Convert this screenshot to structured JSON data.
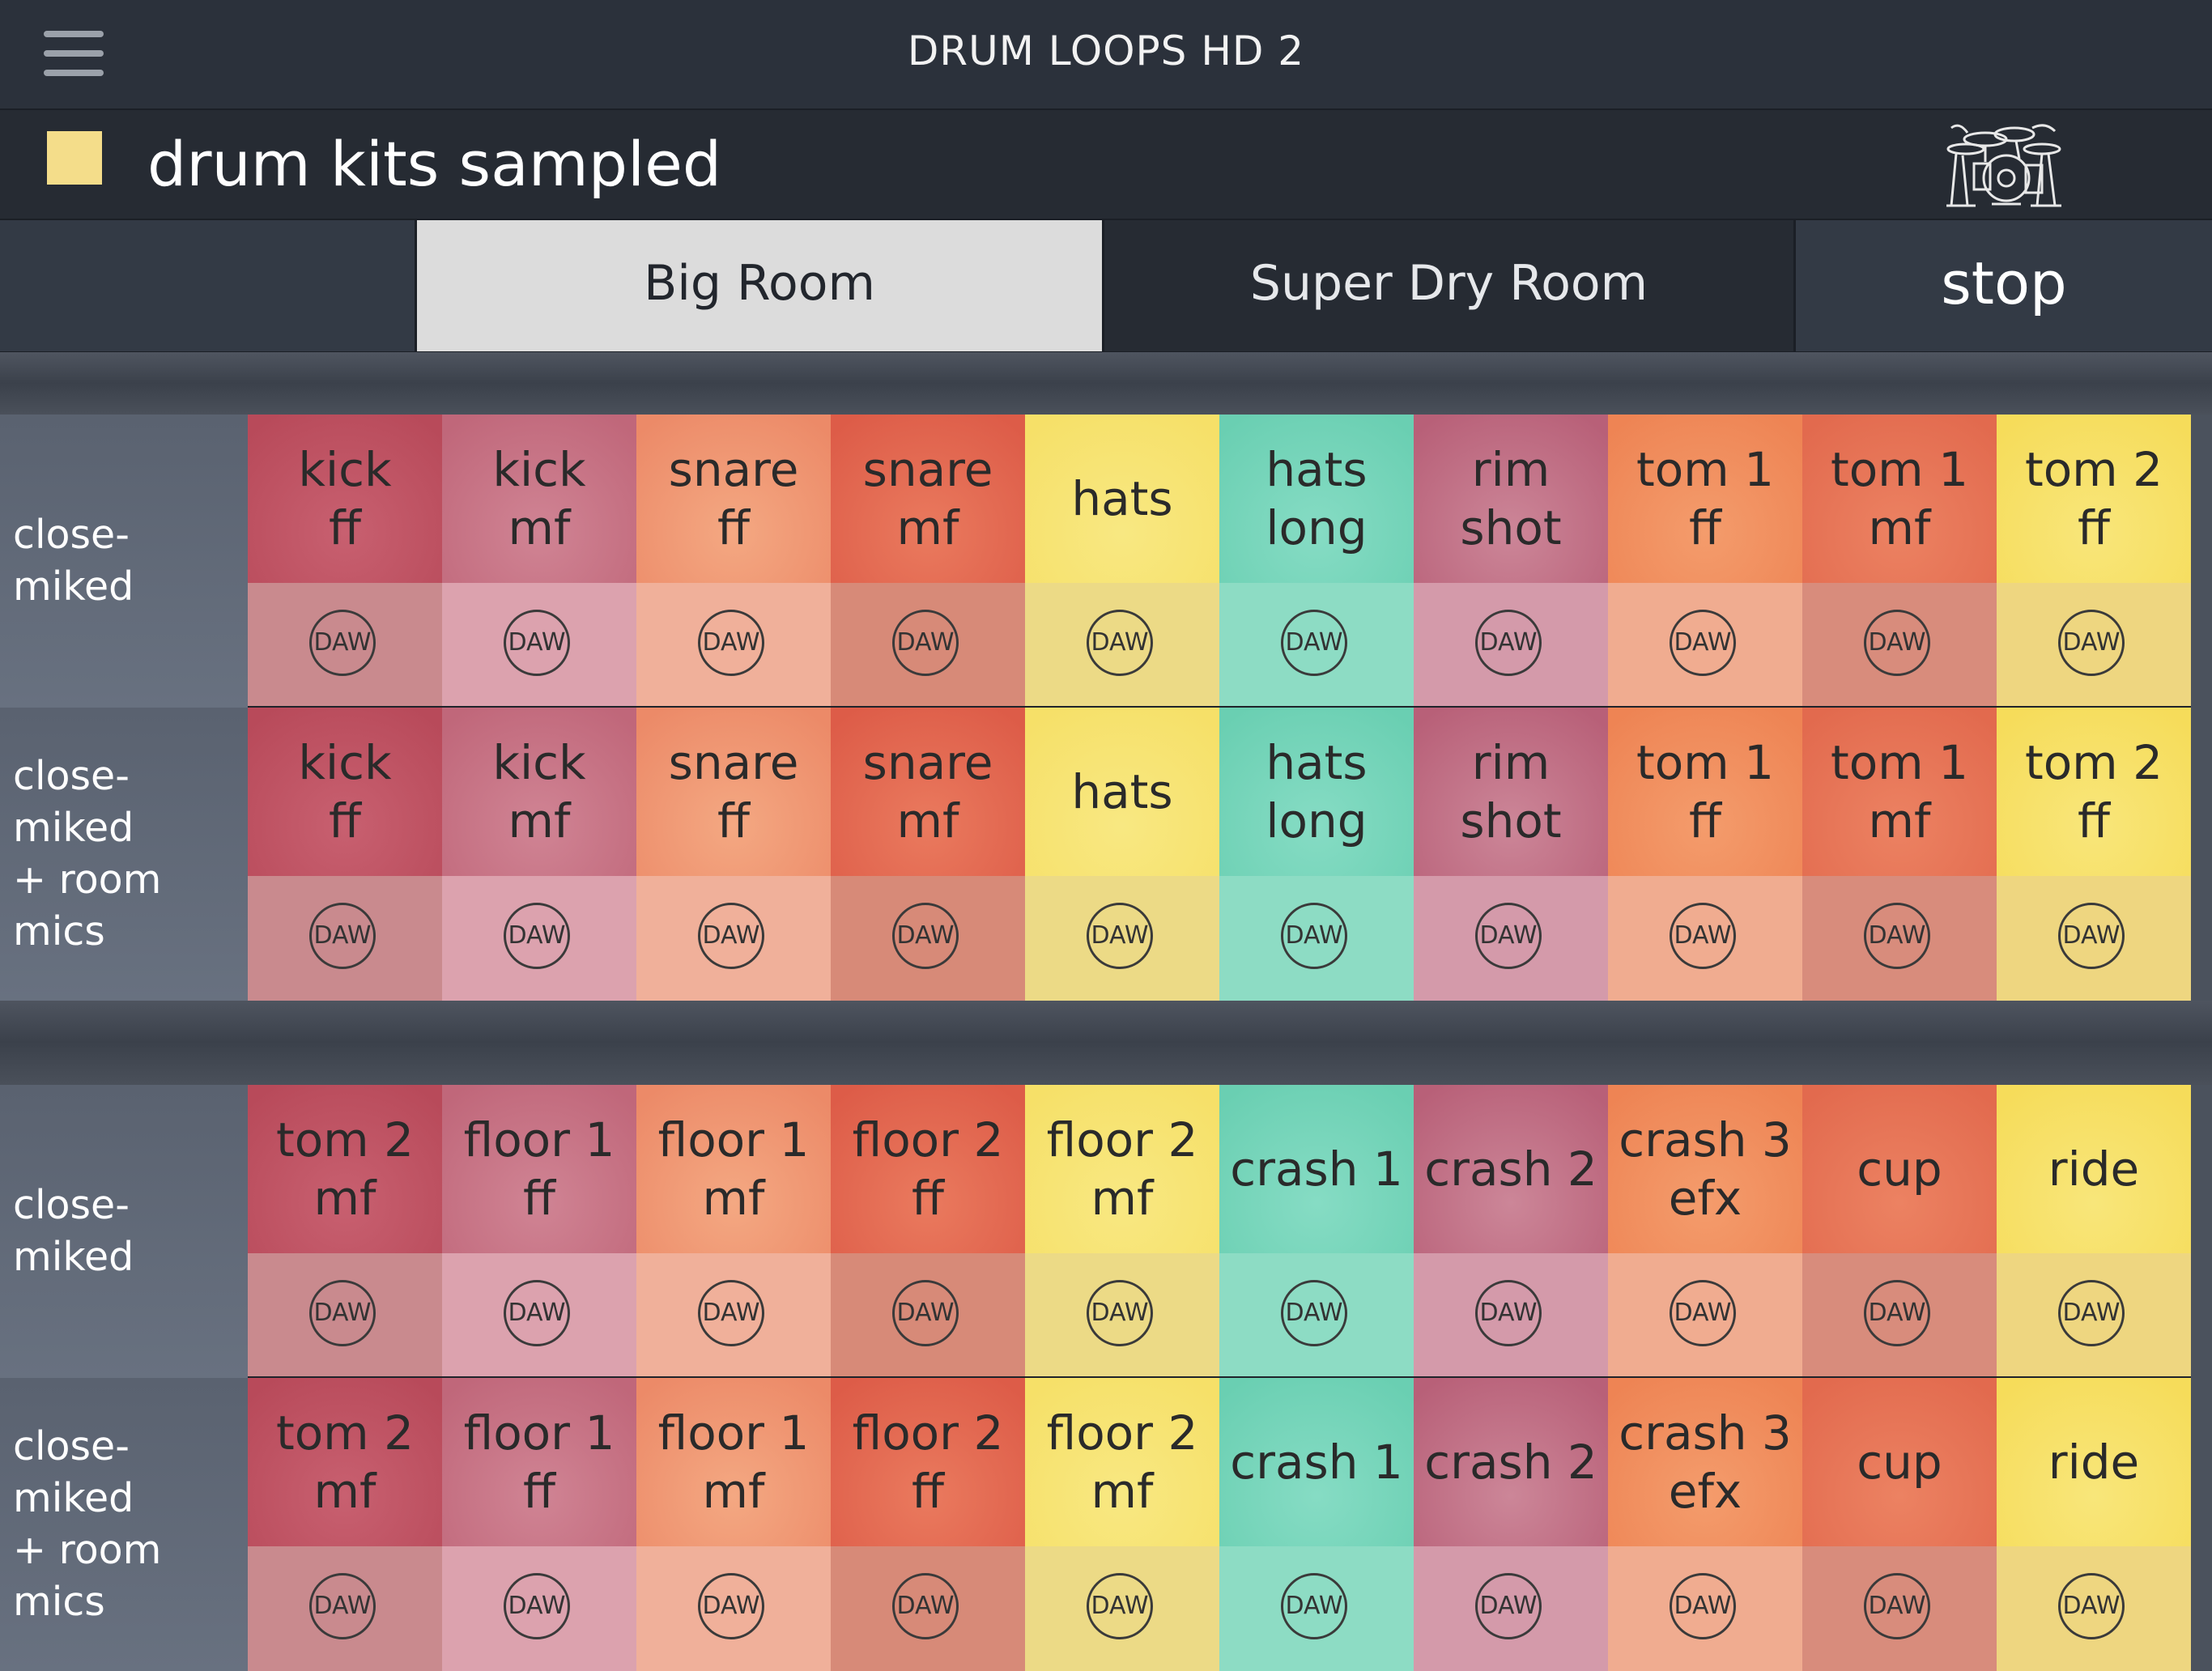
{
  "header": {
    "title": "DRUM LOOPS HD 2"
  },
  "kit": {
    "title": "drum kits sampled",
    "swatch_color": "#f4dd8a",
    "icon": "drum-kit-icon"
  },
  "tabs": {
    "big_room": "Big Room",
    "super_dry_room": "Super Dry Room",
    "stop": "stop",
    "selected": "Big Room"
  },
  "daw_label": "DAW",
  "colors": {
    "dark_red": [
      "#b84a5a",
      "#c86070"
    ],
    "pink": [
      "#c0677a",
      "#d08494"
    ],
    "light_orange": [
      "#ec8a68",
      "#f4a882"
    ],
    "orange_red": [
      "#dd5c48",
      "#ea7a5e"
    ],
    "yellow": [
      "#f6e068",
      "#f8e882"
    ],
    "teal": [
      "#6acfb2",
      "#86dcc4"
    ],
    "mauve": [
      "#b86078",
      "#cc8698"
    ],
    "orange": [
      "#ee8454",
      "#f49c6c"
    ],
    "red_orange": [
      "#e26a4e",
      "#ec8262"
    ],
    "gold": [
      "#f6dc5a",
      "#f8e67a"
    ]
  },
  "daw_colors": [
    "#c98a8e",
    "#dca2ae",
    "#f0b09a",
    "#d78a78",
    "#ecda86",
    "#8ddcc4",
    "#d49aaa",
    "#f0ac90",
    "#d88c7c",
    "#eed680"
  ],
  "sections": [
    {
      "rows": [
        {
          "label": "close-miked",
          "pads": [
            "kick\nff",
            "kick\nmf",
            "snare\nff",
            "snare\nmf",
            "hats",
            "hats\nlong",
            "rim\nshot",
            "tom 1\nff",
            "tom 1\nmf",
            "tom 2\nff"
          ]
        },
        {
          "label": "close-miked\n+ room mics",
          "pads": [
            "kick\nff",
            "kick\nmf",
            "snare\nff",
            "snare\nmf",
            "hats",
            "hats\nlong",
            "rim\nshot",
            "tom 1\nff",
            "tom 1\nmf",
            "tom 2\nff"
          ]
        }
      ]
    },
    {
      "rows": [
        {
          "label": "close-miked",
          "pads": [
            "tom 2\nmf",
            "floor 1\nff",
            "floor 1\nmf",
            "floor 2\nff",
            "floor 2\nmf",
            "crash 1",
            "crash 2",
            "crash 3\nefx",
            "cup",
            "ride"
          ]
        },
        {
          "label": "close-miked\n+ room mics",
          "pads": [
            "tom 2\nmf",
            "floor 1\nff",
            "floor 1\nmf",
            "floor 2\nff",
            "floor 2\nmf",
            "crash 1",
            "crash 2",
            "crash 3\nefx",
            "cup",
            "ride"
          ]
        }
      ]
    }
  ]
}
